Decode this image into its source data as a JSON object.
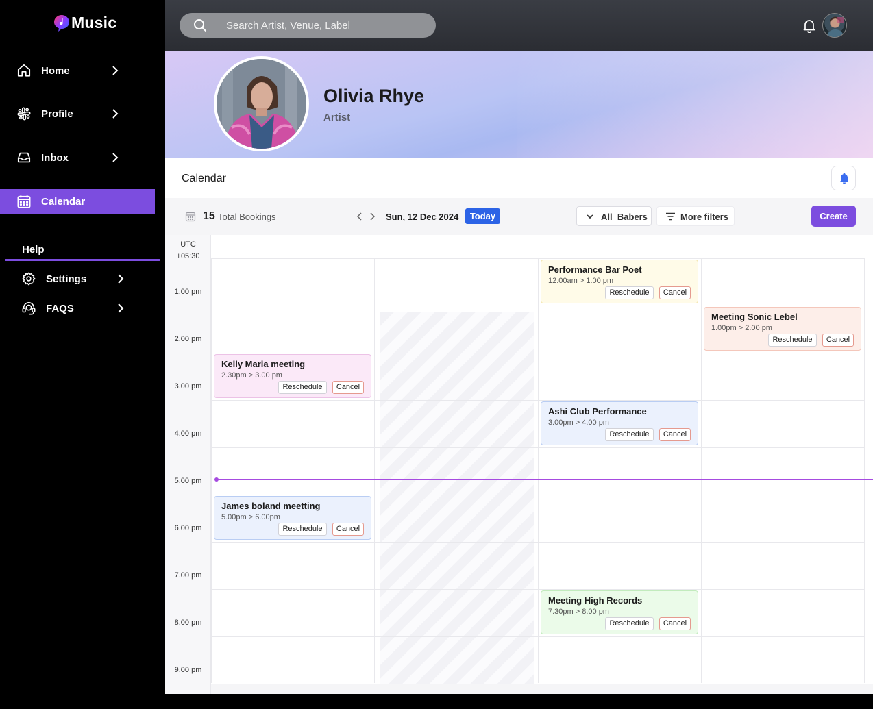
{
  "app": {
    "logo_text": "Music"
  },
  "sidebar": {
    "items": [
      {
        "label": "Home"
      },
      {
        "label": "Profile"
      },
      {
        "label": "Inbox"
      },
      {
        "label": "Calendar"
      }
    ],
    "help_label": "Help",
    "help_items": [
      {
        "label": "Settings"
      },
      {
        "label": "FAQS"
      }
    ],
    "accent_color": "#7c4ddf"
  },
  "search": {
    "placeholder": "Search Artist, Venue, Label"
  },
  "profile": {
    "name": "Olivia Rhye",
    "role": "Artist"
  },
  "calendar": {
    "title": "Calendar",
    "total_count": "15",
    "total_label": "Total Bookings",
    "date": "Sun, 12 Dec 2024",
    "today_label": "Today",
    "filter_barbers": "All  Babers",
    "filter_more": "More filters",
    "create_label": "Create",
    "timezone_line1": "UTC",
    "timezone_line2": "+05:30",
    "time_labels": [
      "1.00 pm",
      "2.00 pm",
      "3.00 pm",
      "4.00 pm",
      "5.00 pm",
      "6.00 pm",
      "7.00 pm",
      "8.00 pm",
      "9.00 pm"
    ],
    "reschedule_label": "Reschedule",
    "cancel_label": "Cancel",
    "events": [
      {
        "title": "Performance Bar Poet",
        "time": "12.00am > 1.00 pm",
        "bg": "#fffbe8",
        "border": "#f3e6b0"
      },
      {
        "title": "Meeting Sonic Lebel",
        "time": "1.00pm > 2.00 pm",
        "bg": "#fdeee9",
        "border": "#f4c7bb"
      },
      {
        "title": "Kelly Maria meeting",
        "time": "2.30pm > 3.00 pm",
        "bg": "#fbe9f8",
        "border": "#ecc2e6"
      },
      {
        "title": "Ashi Club Performance",
        "time": "3.00pm > 4.00 pm",
        "bg": "#ebf1fd",
        "border": "#b9cdf3"
      },
      {
        "title": "James boland meetting",
        "time": "5.00pm > 6.00pm",
        "bg": "#ebf1fd",
        "border": "#b9cdf3"
      },
      {
        "title": "Meeting High Records",
        "time": "7.30pm > 8.00 pm",
        "bg": "#ebfbe9",
        "border": "#c2ebbd"
      }
    ]
  }
}
